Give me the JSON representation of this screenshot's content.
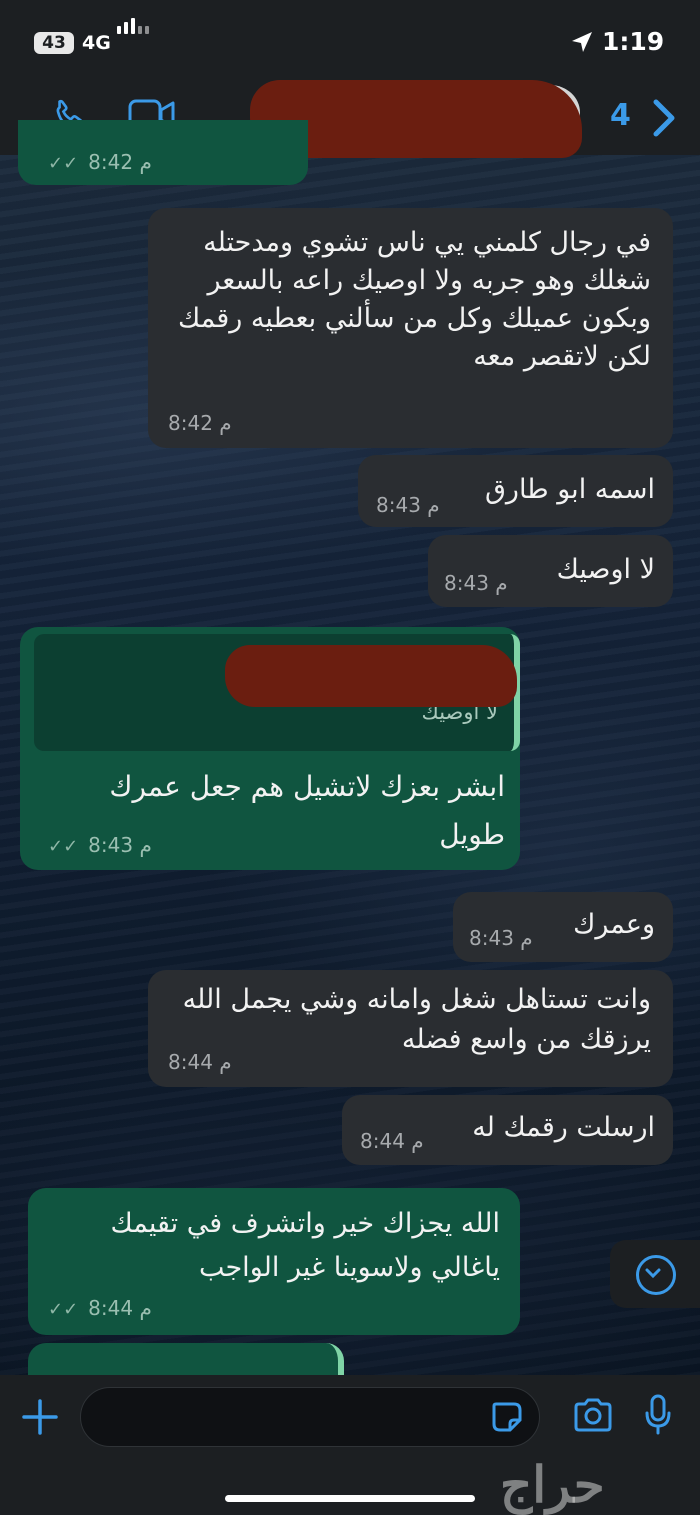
{
  "status_bar": {
    "battery": "43",
    "network": "4G",
    "time": "1:19"
  },
  "header": {
    "unread_count": "4"
  },
  "messages": [
    {
      "direction": "outgoing",
      "text": "",
      "time": "8:42 م"
    },
    {
      "direction": "incoming",
      "text": "في رجال كلمني يي ناس تشوي ومدحتله شغلك وهو جربه ولا اوصيك راعه بالسعر وبكون عميلك وكل من سألني بعطيه رقمك لكن لاتقصر معه",
      "time": "8:42 م"
    },
    {
      "direction": "incoming",
      "text": "اسمه ابو طارق",
      "time": "8:43 م"
    },
    {
      "direction": "incoming",
      "text": "لا اوصيك",
      "time": "8:43 م"
    },
    {
      "direction": "outgoing",
      "quote": "لا اوصيك",
      "text": "ابشر بعزك لاتشيل هم جعل عمرك طويل",
      "time": "8:43 م"
    },
    {
      "direction": "incoming",
      "text": "وعمرك",
      "time": "8:43 م"
    },
    {
      "direction": "incoming",
      "text": "وانت تستاهل شغل وامانه وشي يجمل الله يرزقك من واسع فضله",
      "time": "8:44 م"
    },
    {
      "direction": "incoming",
      "text": "ارسلت رقمك له",
      "time": "8:44 م"
    },
    {
      "direction": "outgoing",
      "text": "الله يجزاك خير واتشرف في تقيمك ياغالي ولاسوينا غير الواجب",
      "time": "8:44 م"
    }
  ],
  "input": {
    "value": ""
  },
  "watermark": "حراج",
  "colors": {
    "accent": "#3b9ae8",
    "outgoing_bubble": "#105540",
    "incoming_bubble": "#2a2d31"
  },
  "icons": {
    "call": "phone-icon",
    "video": "video-camera-icon",
    "back": "chevron-right-icon",
    "add": "plus-icon",
    "sticker": "sticker-icon",
    "camera": "camera-icon",
    "mic": "microphone-icon",
    "scroll": "chevron-down-icon"
  }
}
